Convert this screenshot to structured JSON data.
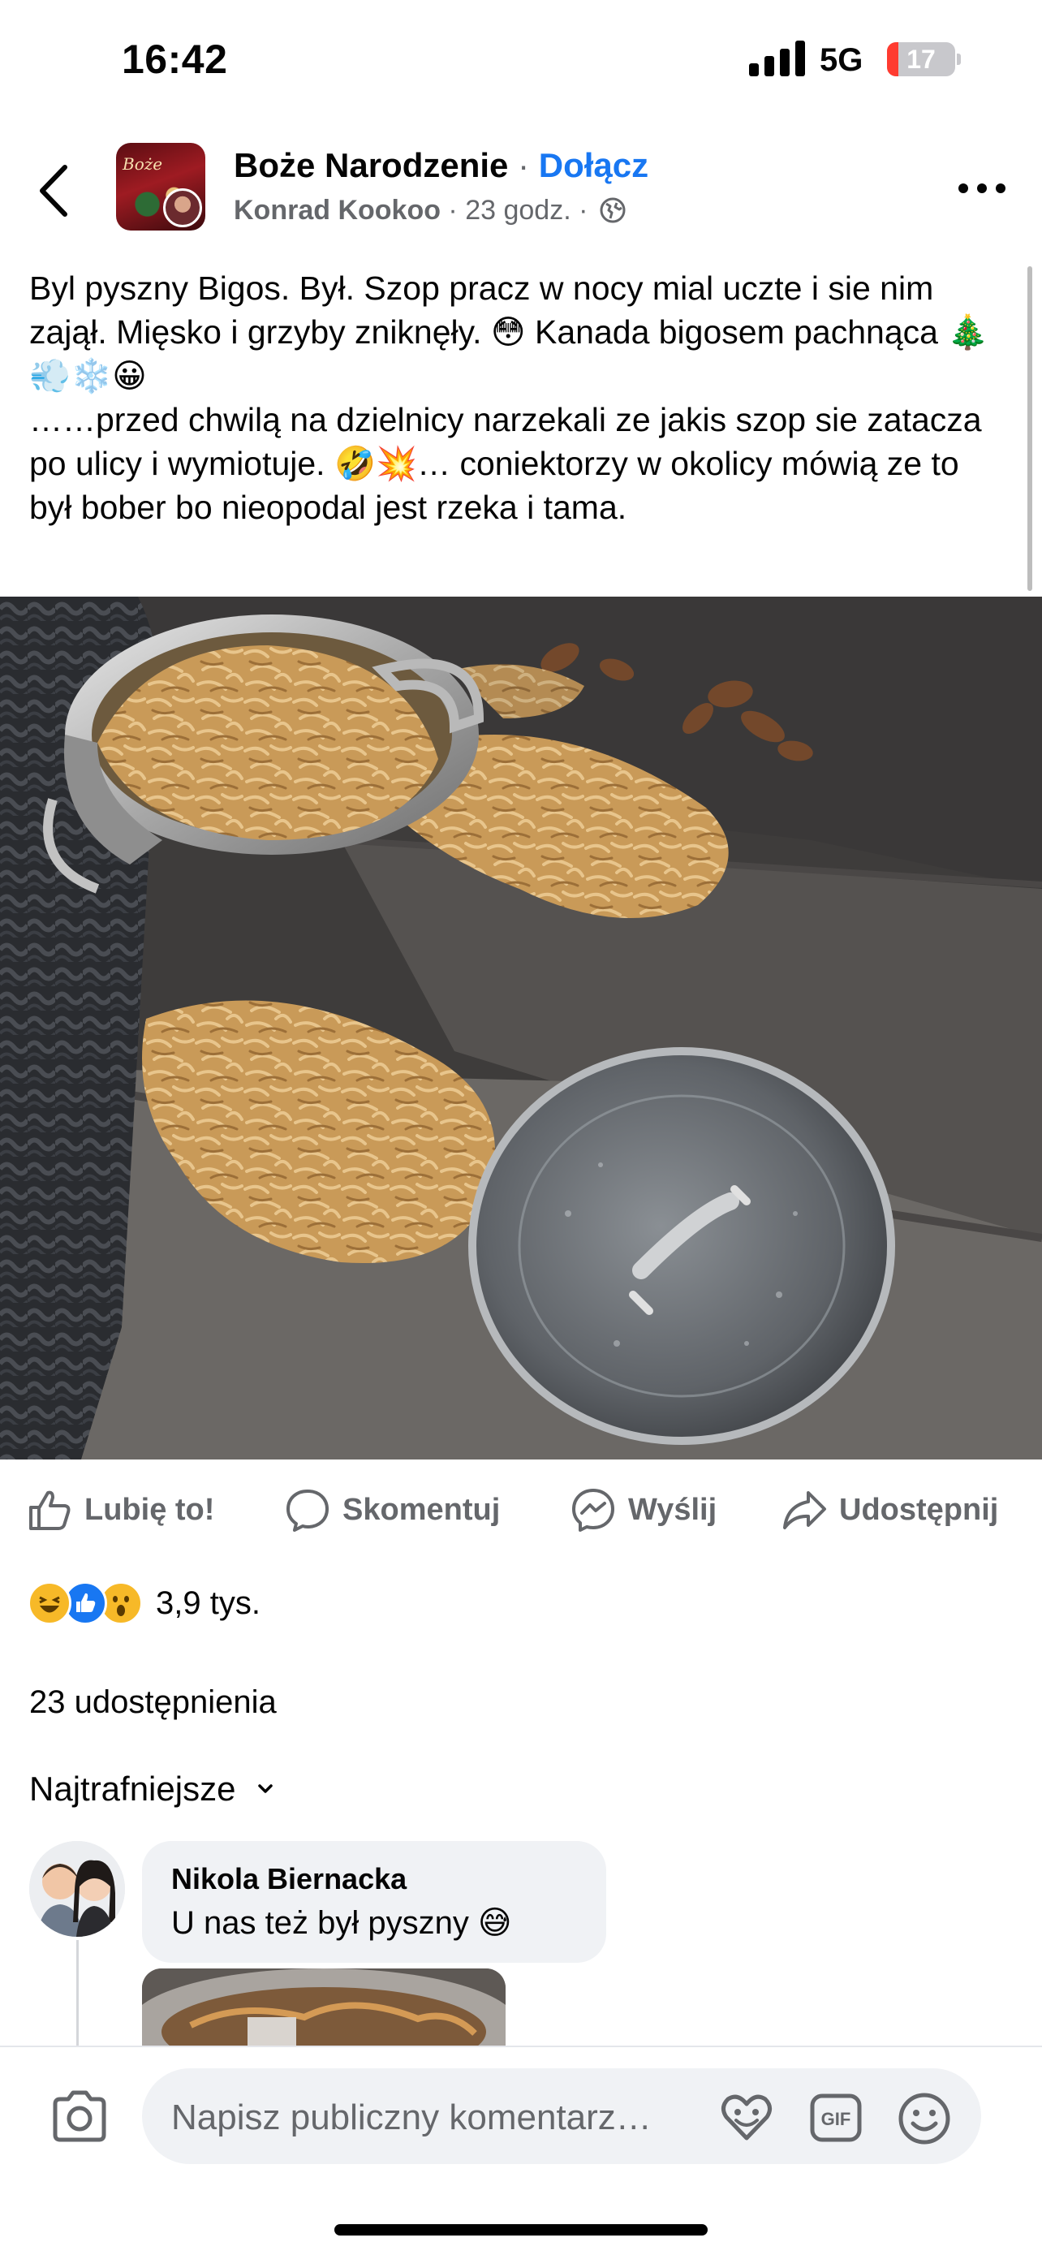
{
  "status_bar": {
    "time": "16:42",
    "network": "5G",
    "battery_level": "17",
    "battery_fraction": 0.17
  },
  "post": {
    "group_name": "Boże Narodzenie",
    "separator": " · ",
    "join_label": "Dołącz",
    "author": "Konrad Kookoo",
    "meta_sep": " · ",
    "time_ago": "23 godz.",
    "meta_sep2": " · ",
    "avatar_text": "Boże",
    "text": "Byl pyszny Bigos. Był. Szop pracz w nocy mial uczte i sie nim zajął. Mięsko i grzyby zniknęły. 😳 Kanada bigosem pachnąca 🎄 💨❄️😀\n……przed chwilą na dzielnicy narzekali ze jakis szop sie zatacza po ulicy i wymiotuje. 🤣💥… coniektorzy w okolicy mówią ze to był bober bo nieopodal jest rzeka i tama."
  },
  "actions": {
    "like": "Lubię to!",
    "comment": "Skomentuj",
    "send": "Wyślij",
    "share": "Udostępnij"
  },
  "reactions": {
    "count": "3,9 tys.",
    "types": [
      "haha",
      "like",
      "wow"
    ]
  },
  "shares": "23 udostępnienia",
  "sort_label": "Najtrafniejsze",
  "comments": [
    {
      "author": "Nikola Biernacka",
      "text": "U nas też był pyszny 😅"
    }
  ],
  "composer": {
    "placeholder": "Napisz publiczny komentarz…",
    "gif_label": "GIF"
  },
  "colors": {
    "accent": "#1877f2",
    "secondary_text": "#65676b",
    "bubble": "#f0f2f5",
    "battery_low": "#ff3b30"
  },
  "icons": [
    "back-icon",
    "globe-icon",
    "more-icon",
    "like-icon",
    "comment-icon",
    "messenger-icon",
    "share-icon",
    "camera-icon",
    "sticker-icon",
    "gif-icon",
    "emoji-icon",
    "chevron-down-icon"
  ]
}
